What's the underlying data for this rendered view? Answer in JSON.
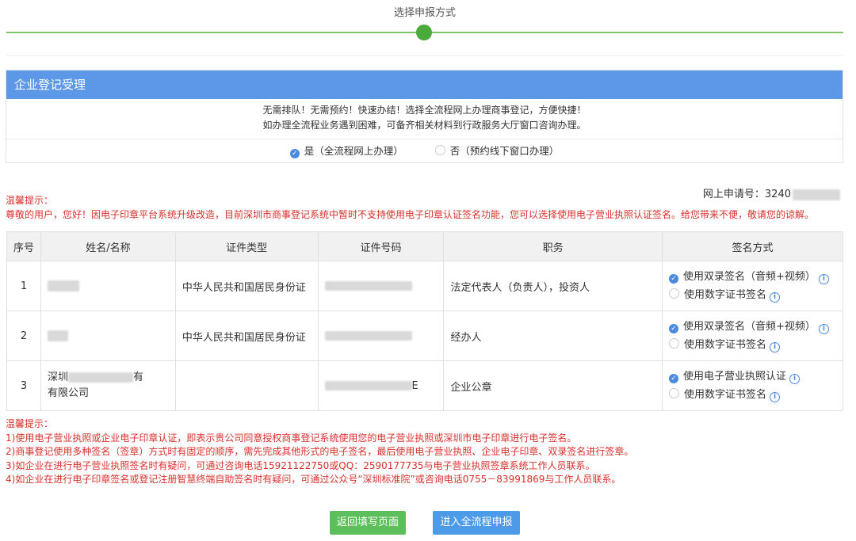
{
  "stepper": {
    "title": "选择申报方式"
  },
  "panel": {
    "title": "企业登记受理",
    "message_line1": "无需排队！无需预约！快速办结！选择全流程网上办理商事登记，方便快捷！",
    "message_line2": "如办理全流程业务遇到困难，可备齐相关材料到行政服务大厅窗口咨询办理。",
    "option_yes": "是（全流程网上办理）",
    "option_no": "否（预约线下窗口办理）"
  },
  "application_no": {
    "label": "网上申请号：",
    "value": "3240"
  },
  "notice_top": {
    "title": "温馨提示：",
    "text": "尊敬的用户，您好！因电子印章平台系统升级改造，目前深圳市商事登记系统中暂时不支持使用电子印章认证签名功能，您可以选择使用电子营业执照认证签名。给您带来不便，敬请您的谅解。"
  },
  "table": {
    "headers": [
      "序号",
      "姓名/名称",
      "证件类型",
      "证件号码",
      "职务",
      "签名方式"
    ],
    "rows": [
      {
        "no": "1",
        "id_type": "中华人民共和国居民身份证",
        "position": "法定代表人（负责人），投资人",
        "sig_on": "使用双录签名（音频+视频）",
        "sig_off": "使用数字证书签名"
      },
      {
        "no": "2",
        "id_type": "中华人民共和国居民身份证",
        "position": "经办人",
        "sig_on": "使用双录签名（音频+视频）",
        "sig_off": "使用数字证书签名"
      },
      {
        "no": "3",
        "name_a": "深圳",
        "name_b": "有限公司",
        "name_tail": "有",
        "id_tail": "E",
        "id_type": "",
        "position": "企业公章",
        "sig_on": "使用电子营业执照认证",
        "sig_off": "使用数字证书签名"
      }
    ]
  },
  "notice_bottom": {
    "title": "温馨提示：",
    "lines": [
      "1)使用电子营业执照或企业电子印章认证，即表示贵公司同意授权商事登记系统使用您的电子营业执照或深圳市电子印章进行电子签名。",
      "2)商事登记使用多种签名（签章）方式时有固定的顺序，需先完成其他形式的电子签名，最后使用电子营业执照、企业电子印章、双录签名进行签章。",
      "3)如企业在进行电子营业执照签名时有疑问，可通过咨询电话15921122750或QQ：2590177735与电子营业执照签章系统工作人员联系。",
      "4)如企业在进行电子印章签名或登记注册智慧终端自助签名时有疑问，可通过公众号“深圳标准院”或咨询电话0755－83991869与工作人员联系。"
    ]
  },
  "buttons": {
    "back": "返回填写页面",
    "proceed": "进入全流程申报"
  },
  "colors": {
    "accent_blue": "#5d97e8",
    "step_green": "#4aaa3a",
    "warn_red": "#d9302c"
  }
}
